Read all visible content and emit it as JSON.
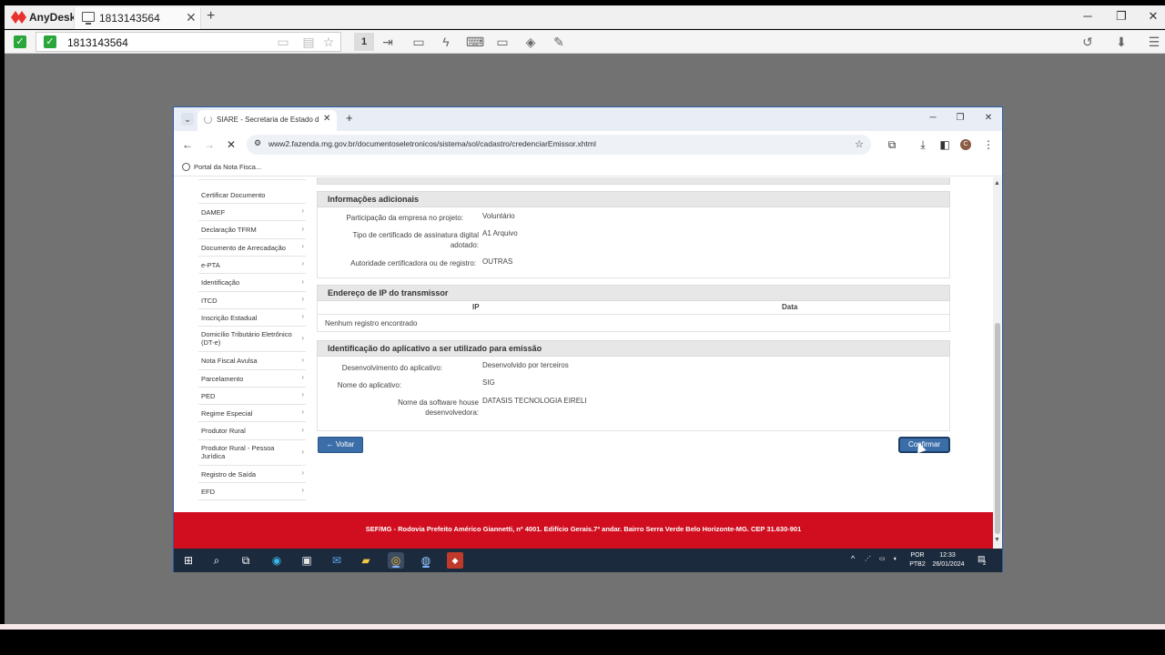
{
  "anydesk": {
    "app_name": "AnyDesk",
    "tab_title": "1813143564",
    "address": "1813143564",
    "toolbar_number": "1"
  },
  "chrome": {
    "tab_title": "SIARE - Secretaria de Estado de",
    "url": "www2.fazenda.mg.gov.br/documentoseletronicos/sistema/sol/cadastro/credenciarEmissor.xhtml",
    "bookmark": "Portal da Nota Fisca...",
    "profile_initial": "C"
  },
  "sidebar": {
    "items": [
      {
        "label": "Certificar Documento"
      },
      {
        "label": "DAMEF"
      },
      {
        "label": "Declaração TFRM"
      },
      {
        "label": "Documento de Arrecadação"
      },
      {
        "label": "e-PTA"
      },
      {
        "label": "Identificação"
      },
      {
        "label": "ITCD"
      },
      {
        "label": "Inscrição Estadual"
      },
      {
        "label": "Domicílio Tributário Eletrônico (DT-e)"
      },
      {
        "label": "Nota Fiscal Avulsa"
      },
      {
        "label": "Parcelamento"
      },
      {
        "label": "PED"
      },
      {
        "label": "Regime Especial"
      },
      {
        "label": "Produtor Rural"
      },
      {
        "label": "Produtor Rural - Pessoa Jurídica"
      },
      {
        "label": "Registro de Saída"
      },
      {
        "label": "EFD"
      }
    ]
  },
  "info_adicionais": {
    "title": "Informações adicionais",
    "participacao_label": "Participação da empresa no projeto:",
    "participacao_value": "Voluntário",
    "tipo_cert_label": "Tipo de certificado de assinatura digital adotado:",
    "tipo_cert_value": "A1 Arquivo",
    "autoridade_label": "Autoridade certificadora ou de registro:",
    "autoridade_value": "OUTRAS"
  },
  "endereco_ip": {
    "title": "Endereço de IP do transmissor",
    "col_ip": "IP",
    "col_data": "Data",
    "empty": "Nenhum registro encontrado"
  },
  "aplicativo": {
    "title": "Identificação do aplicativo a ser utilizado para emissão",
    "desenvolvimento_label": "Desenvolvimento do aplicativo:",
    "desenvolvimento_value": "Desenvolvido por terceiros",
    "nome_label": "Nome do aplicativo:",
    "nome_value": "SIG",
    "software_house_label": "Nome da software house desenvolvedora:",
    "software_house_value": "DATASIS TECNOLOGIA EIRELI"
  },
  "buttons": {
    "voltar": "← Voltar",
    "confirmar": "Confirmar"
  },
  "footer": {
    "text": "SEF/MG - Rodovia Prefeito Américo Giannetti, nº 4001. Edifício Gerais.7º andar. Bairro Serra Verde Belo Horizonte-MG. CEP 31.630-901"
  },
  "taskbar": {
    "lang_top": "POR",
    "lang_bottom": "PTB2",
    "time": "12:33",
    "date": "26/01/2024",
    "notifications": "2"
  }
}
